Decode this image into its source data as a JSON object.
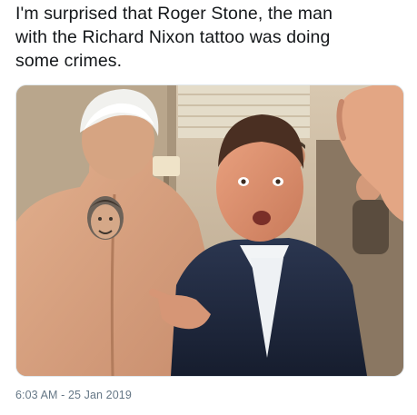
{
  "tweet": {
    "text": "I'm surprised that Roger Stone, the man\nwith the Richard Nixon tattoo was doing\nsome crimes.",
    "timestamp": "6:03 AM - 25 Jan 2019"
  },
  "media": {
    "description_icon": "photo-icon"
  },
  "colors": {
    "text": "#14171a",
    "meta": "#657786",
    "border": "#e1e8ed"
  }
}
